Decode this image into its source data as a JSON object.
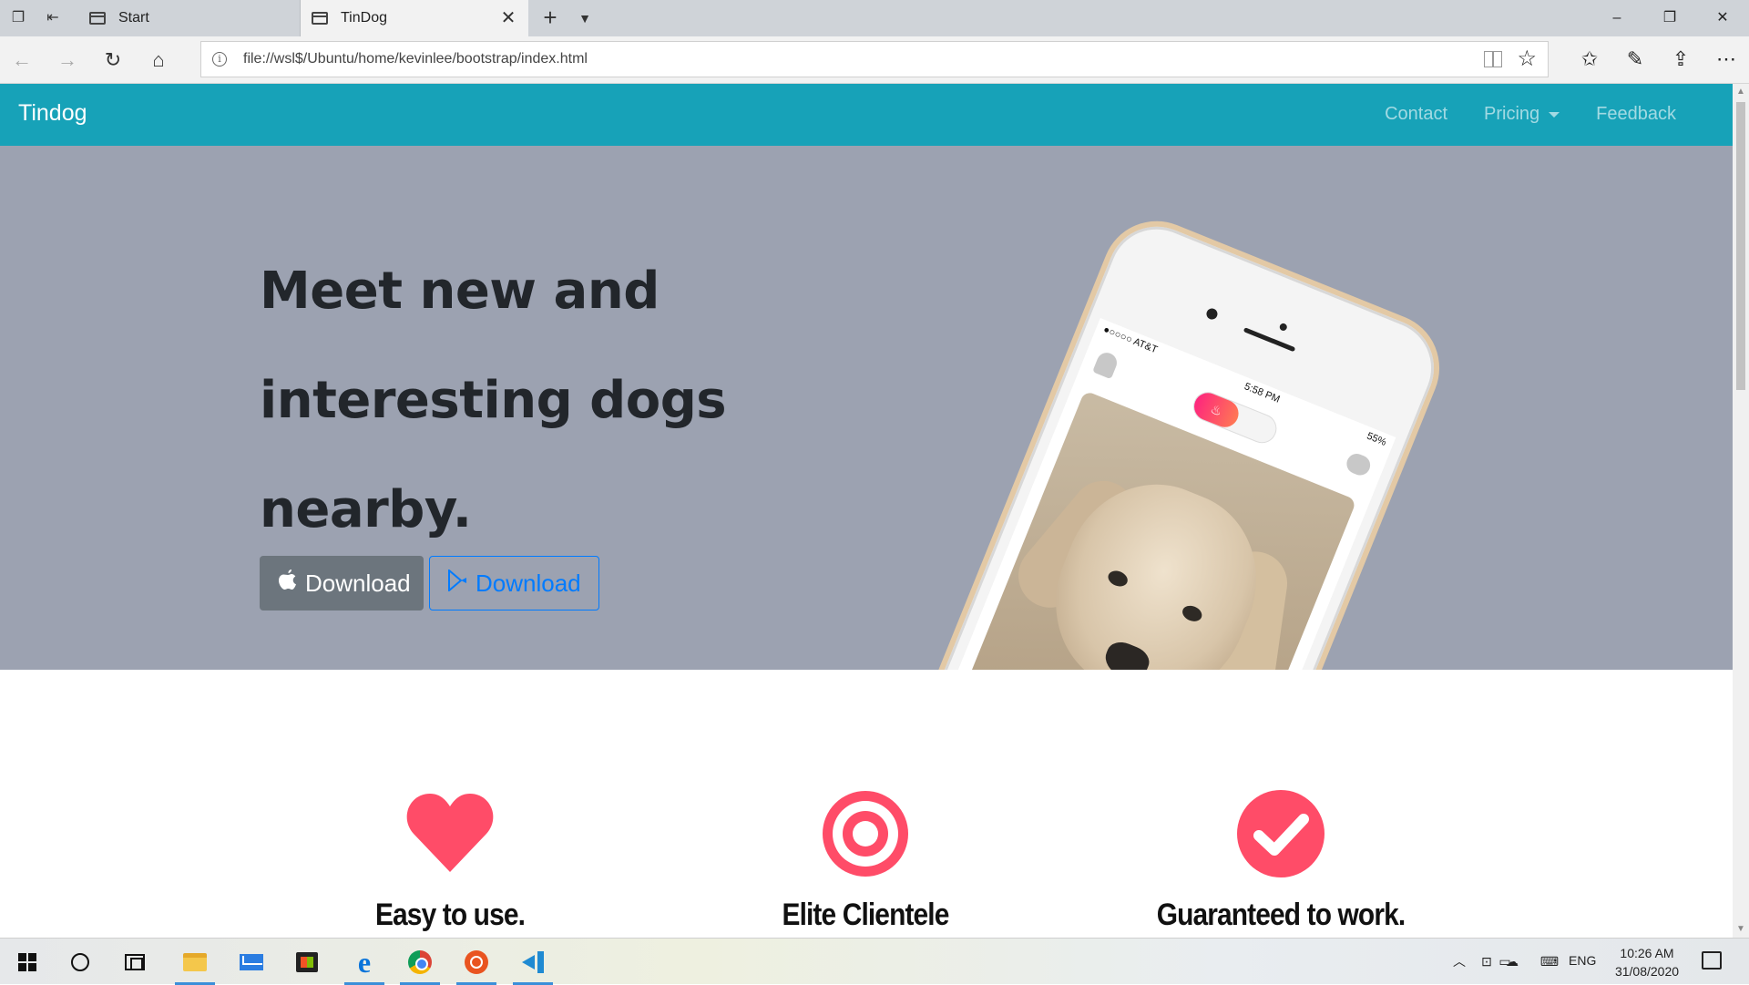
{
  "browser": {
    "tabs": [
      {
        "label": "Start",
        "active": false
      },
      {
        "label": "TinDog",
        "active": true
      }
    ],
    "url": "file://wsl$/Ubuntu/home/kevinlee/bootstrap/index.html",
    "icons": {
      "back": "arrow-left-icon",
      "forward": "arrow-right-icon",
      "refresh": "refresh-icon",
      "home": "home-icon",
      "favorites": "star-icon",
      "favorites_bar": "favorites-list-icon",
      "notes": "pen-icon",
      "share": "share-icon",
      "more": "more-icon"
    },
    "window_controls": {
      "minimize": "–",
      "restore": "❐",
      "close": "✕"
    }
  },
  "site": {
    "brand": "Tindog",
    "nav": {
      "contact": "Contact",
      "pricing": "Pricing",
      "feedback": "Feedback"
    },
    "hero": {
      "headline_line1": "Meet new and",
      "headline_line2": "interesting dogs",
      "headline_line3": "nearby.",
      "btn_apple": "Download",
      "btn_play": "Download",
      "phone": {
        "carrier": "●○○○○ AT&T",
        "time": "5:58 PM",
        "battery": "55%"
      }
    },
    "features": [
      {
        "title": "Easy to use.",
        "icon": "heart-icon",
        "color": "#ff4c68"
      },
      {
        "title": "Elite Clientele",
        "icon": "bullseye-icon",
        "color": "#ff4c68"
      },
      {
        "title": "Guaranteed to work.",
        "icon": "check-circle-icon",
        "color": "#ff4c68"
      }
    ],
    "colors": {
      "navbar": "#17a2b8",
      "hero_bg": "#9ca2b1",
      "accent": "#ff4c68"
    }
  },
  "taskbar": {
    "language": "ENG",
    "time": "10:26 AM",
    "date": "31/08/2020"
  }
}
